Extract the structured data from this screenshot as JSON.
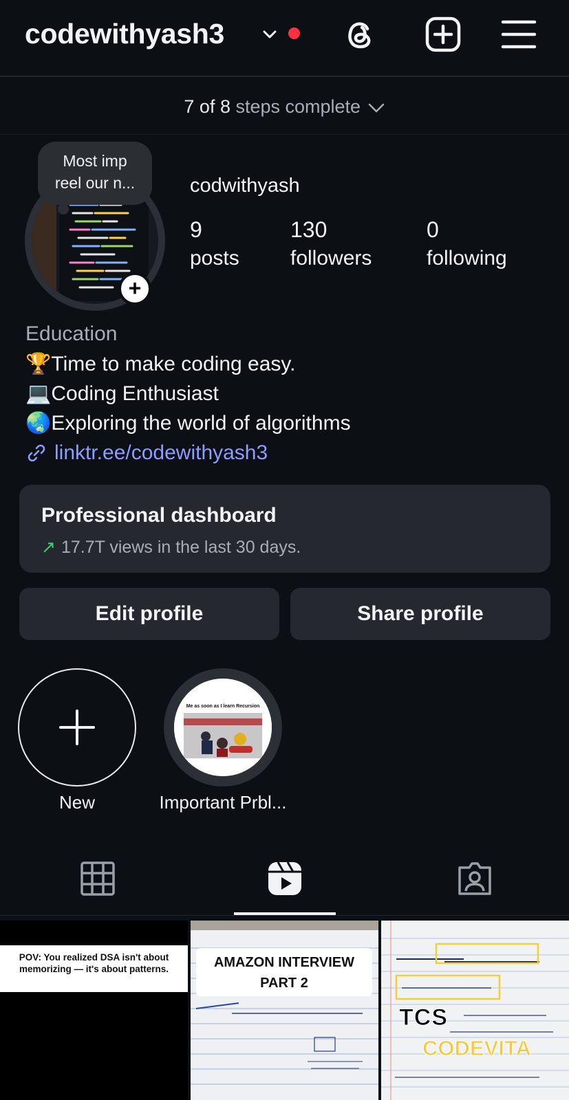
{
  "header": {
    "username": "codewithyash3",
    "icons": [
      "chevron-down-icon",
      "notification-dot",
      "threads-icon",
      "create-post-icon",
      "menu-icon"
    ]
  },
  "setup_steps": {
    "count": "7 of 8",
    "rest": "steps complete"
  },
  "profile": {
    "note_line1": "Most imp",
    "note_line2": "reel our n...",
    "display_name": "codwithyash",
    "stats": [
      {
        "num": "9",
        "label": "posts"
      },
      {
        "num": "130",
        "label": "followers"
      },
      {
        "num": "0",
        "label": "following"
      }
    ]
  },
  "bio": {
    "category": "Education",
    "lines": [
      {
        "emoji": "🏆",
        "text": "Time to make coding easy."
      },
      {
        "emoji": "💻",
        "text": "Coding Enthusiast"
      },
      {
        "emoji": "🌏",
        "text": "Exploring the world of algorithms"
      }
    ],
    "link": "linktr.ee/codewithyash3"
  },
  "dashboard": {
    "title": "Professional dashboard",
    "arrow": "↗",
    "subtitle": "17.7T views in the last 30 days."
  },
  "buttons": {
    "edit": "Edit profile",
    "share": "Share profile"
  },
  "highlights": [
    {
      "label": "New"
    },
    {
      "label": "Important Prbl...",
      "thumb_caption": "Me as soon as I learn Recursion"
    }
  ],
  "tabs": [
    "grid-icon",
    "reels-icon",
    "tagged-icon"
  ],
  "reels": [
    {
      "caption": "POV: You realized DSA isn't about memorizing — it's about patterns."
    },
    {
      "caption_line1": "AMAZON INTERVIEW",
      "caption_line2": "PART 2"
    },
    {
      "caption_line1": "TCS",
      "caption_line2": "CODEVITA"
    }
  ],
  "colors": {
    "background": "#0c0f14",
    "card": "#25282e",
    "link": "#8c9dff",
    "accent_red": "#ff3040",
    "trend_green": "#3bd16f"
  }
}
